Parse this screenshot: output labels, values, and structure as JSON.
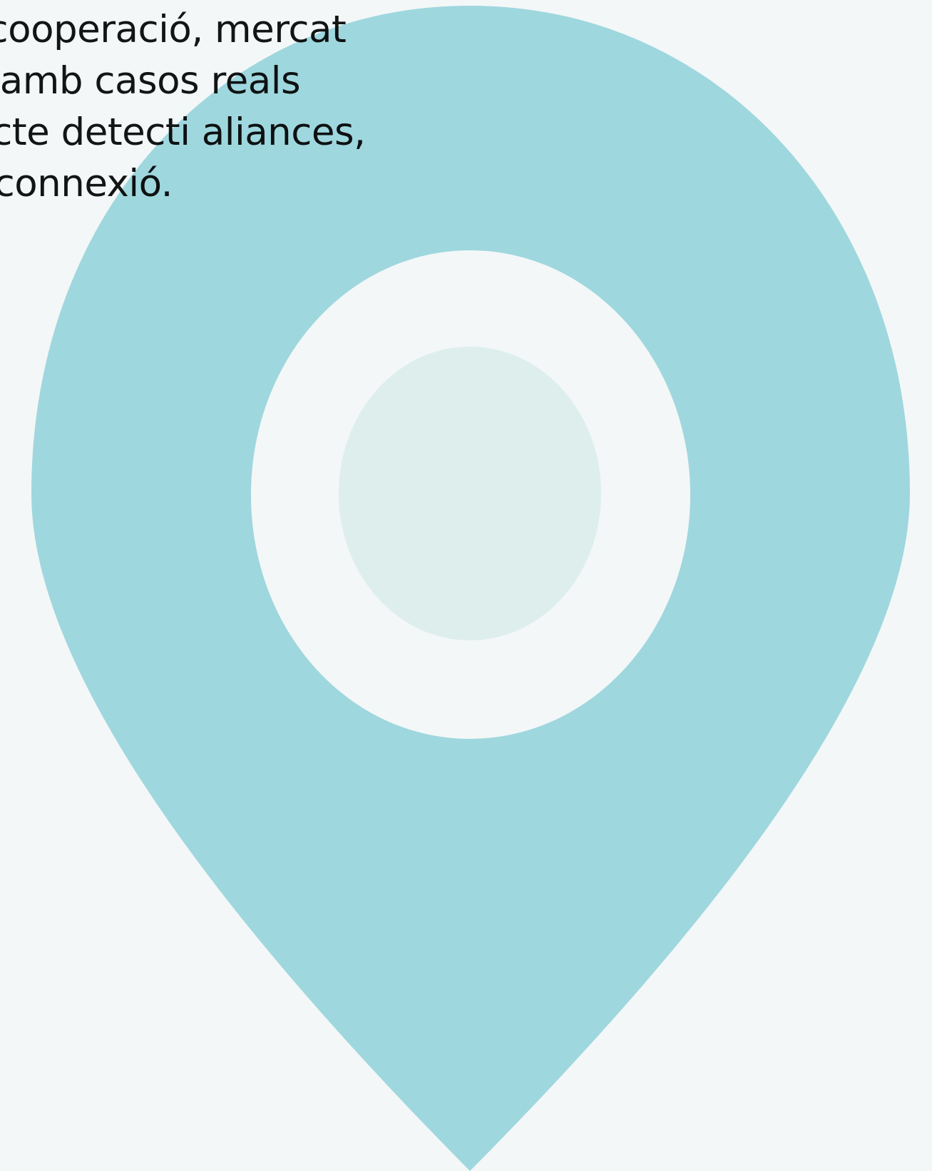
{
  "body_text": {
    "lines": [
      "tercooperació, mercat",
      "ra) amb casos reals",
      "ojecte detecti aliances,",
      "de connexió."
    ]
  },
  "colors": {
    "background": "#f3f7f8",
    "pin_fill": "#9fd7de",
    "pin_core": "#ddeeed",
    "text": "#141414"
  },
  "icons": {
    "pin": "map-pin-icon"
  }
}
